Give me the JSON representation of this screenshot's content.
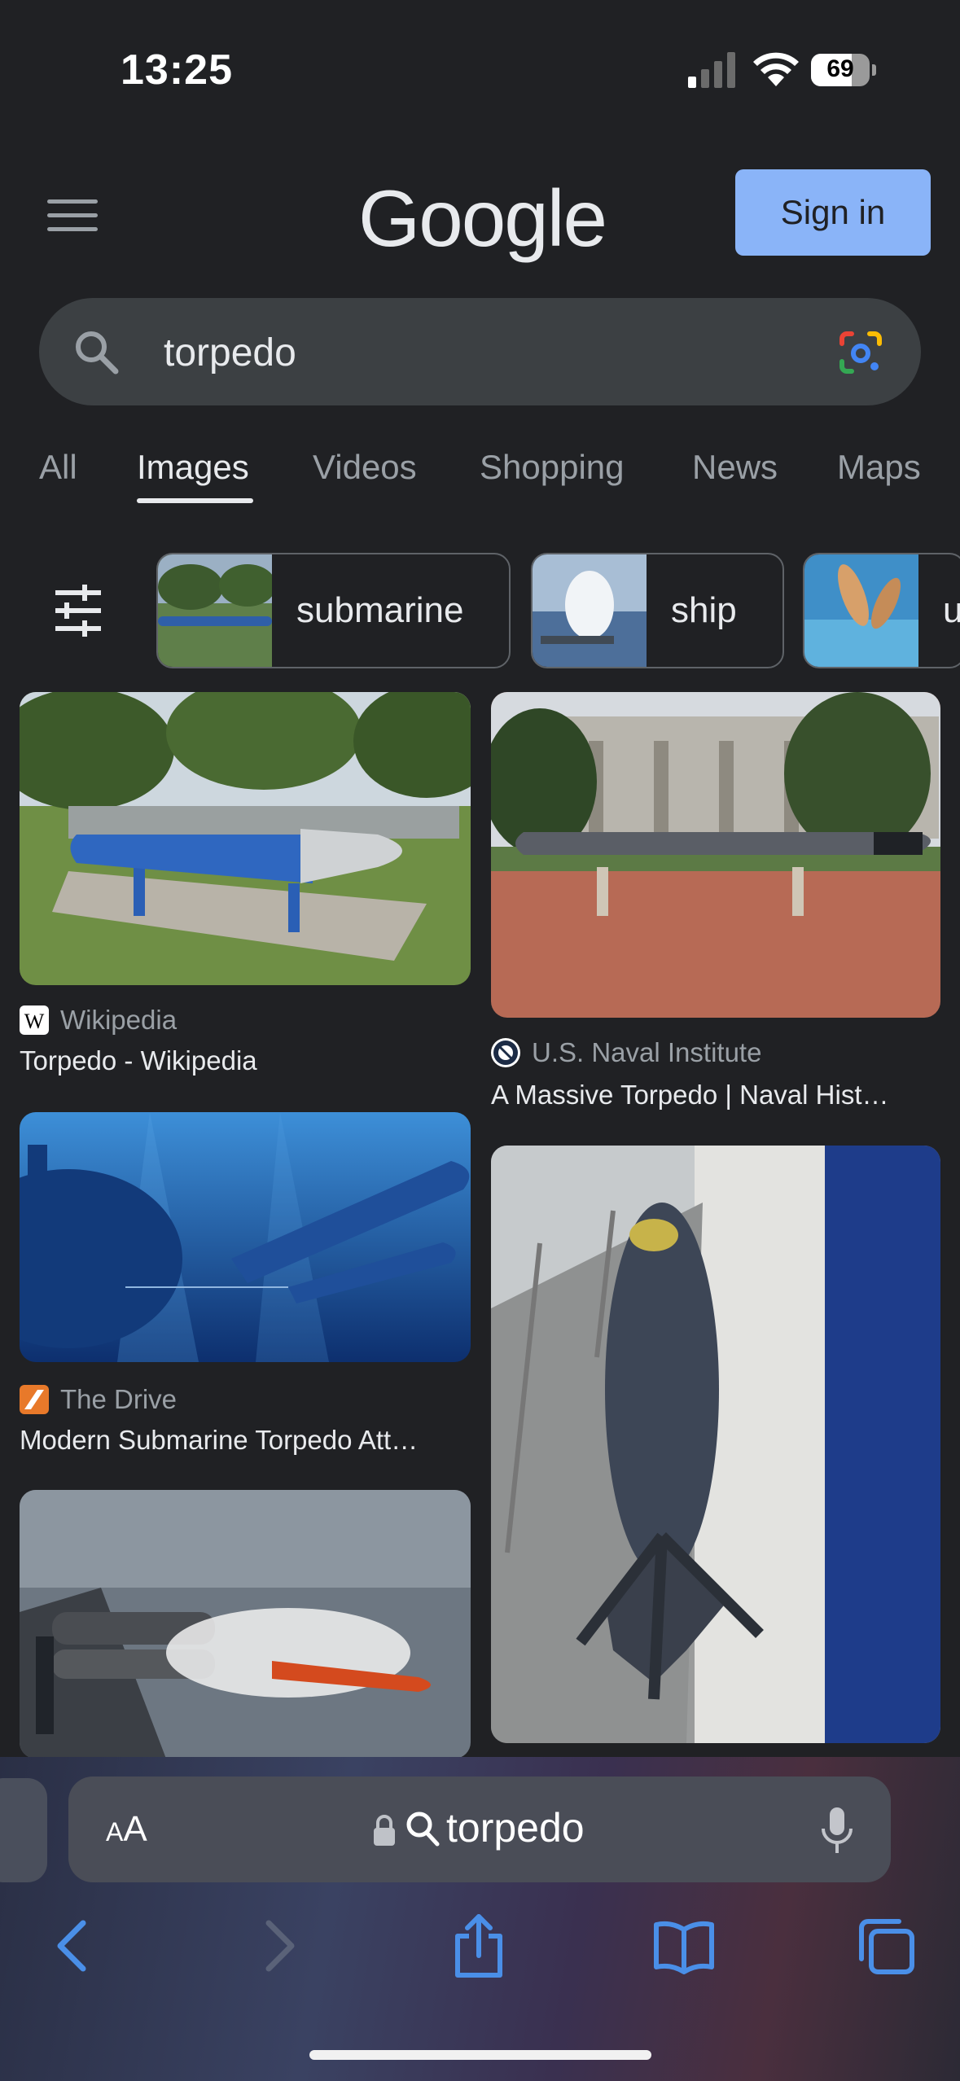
{
  "status_bar": {
    "time": "13:25",
    "battery": "69"
  },
  "header": {
    "logo": "Google",
    "sign_in": "Sign in"
  },
  "search": {
    "query": "torpedo"
  },
  "tabs": [
    {
      "label": "All"
    },
    {
      "label": "Images"
    },
    {
      "label": "Videos"
    },
    {
      "label": "Shopping"
    },
    {
      "label": "News"
    },
    {
      "label": "Maps"
    }
  ],
  "chips": [
    {
      "label": "submarine"
    },
    {
      "label": "ship"
    },
    {
      "label": "u"
    }
  ],
  "results": [
    {
      "source": "Wikipedia",
      "title": "Torpedo - Wikipedia"
    },
    {
      "source": "U.S. Naval Institute",
      "title": "A Massive Torpedo | Naval Hist…"
    },
    {
      "source": "The Drive",
      "title": "Modern Submarine Torpedo Att…"
    },
    {
      "source": "",
      "title": ""
    },
    {
      "source": "",
      "title": ""
    }
  ],
  "browser": {
    "text_size": "AA",
    "address": "torpedo"
  },
  "colors": {
    "background": "#202124",
    "accent": "#8ab4f8",
    "safari_blue": "#4a8fe8"
  },
  "icons": [
    "signal-icon",
    "wifi-icon",
    "menu-icon",
    "search-icon",
    "google-lens-icon",
    "filter-icon",
    "lock-icon",
    "microphone-icon",
    "back-icon",
    "forward-icon",
    "share-icon",
    "bookmarks-icon",
    "tabs-icon"
  ]
}
